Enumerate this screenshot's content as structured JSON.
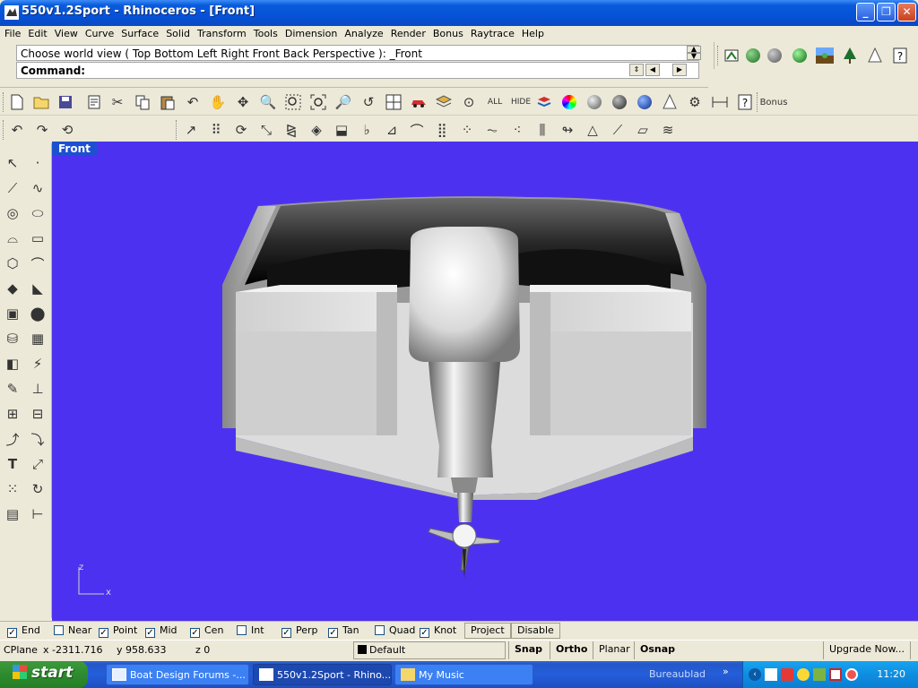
{
  "window": {
    "title": "550v1.2Sport - Rhinoceros - [Front]"
  },
  "menu": [
    "File",
    "Edit",
    "View",
    "Curve",
    "Surface",
    "Solid",
    "Transform",
    "Tools",
    "Dimension",
    "Analyze",
    "Render",
    "Bonus",
    "Raytrace",
    "Help"
  ],
  "command": {
    "history": "Choose world view ( Top  Bottom  Left  Right  Front  Back  Perspective ): _Front",
    "prompt": "Command:",
    "value": ""
  },
  "toolbar": {
    "all_label": "ALL",
    "hide_label": "HIDE",
    "bonus_label": "Bonus"
  },
  "viewport": {
    "label": "Front",
    "axis_z": "z",
    "axis_x": "x"
  },
  "osnap": {
    "items": [
      {
        "label": "End",
        "checked": true
      },
      {
        "label": "Near",
        "checked": false
      },
      {
        "label": "Point",
        "checked": true
      },
      {
        "label": "Mid",
        "checked": true
      },
      {
        "label": "Cen",
        "checked": true
      },
      {
        "label": "Int",
        "checked": false
      },
      {
        "label": "Perp",
        "checked": true
      },
      {
        "label": "Tan",
        "checked": true
      },
      {
        "label": "Quad",
        "checked": false
      },
      {
        "label": "Knot",
        "checked": true
      }
    ],
    "project_label": "Project",
    "disable_label": "Disable"
  },
  "status": {
    "cplane": "CPlane",
    "x": "x -2311.716",
    "y": "y 958.633",
    "z": "z 0",
    "layer": "Default",
    "snap": "Snap",
    "ortho": "Ortho",
    "planar": "Planar",
    "osnap": "Osnap",
    "upgrade": "Upgrade Now..."
  },
  "taskbar": {
    "start": "start",
    "tasks": [
      {
        "label": "Boat Design Forums -..."
      },
      {
        "label": "550v1.2Sport - Rhino..."
      },
      {
        "label": "My Music"
      }
    ],
    "desktop_label": "Bureaublad",
    "clock": "11:20"
  },
  "colors": {
    "viewport_bg": "#4c32f0",
    "title_blue": "#0552d8",
    "start_green": "#2e8a2e"
  }
}
